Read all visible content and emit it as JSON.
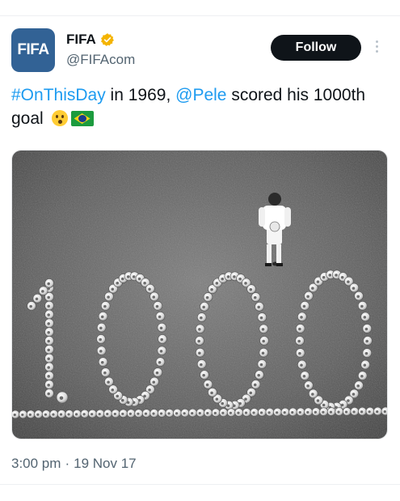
{
  "header": {
    "display_name": "FIFA",
    "handle": "@FIFAcom",
    "avatar_text": "FIFA",
    "follow_label": "Follow",
    "badge_color": "#f4b400",
    "avatar_color": "#326295",
    "more_icon": "more-vertical-icon"
  },
  "tweet": {
    "hashtag": "#OnThisDay",
    "text_1": " in 1969, ",
    "mention": "@Pele",
    "text_2": " scored his 1000th goal",
    "emojis": [
      "hushed-face-emoji",
      "brazil-flag-emoji"
    ],
    "link_color": "#1d9bf0"
  },
  "photo": {
    "subject": "photo-pele-1000-balls",
    "figure_text": "1000"
  },
  "meta": {
    "time": "3:00 pm",
    "separator": "·",
    "date": "19 Nov 17"
  }
}
